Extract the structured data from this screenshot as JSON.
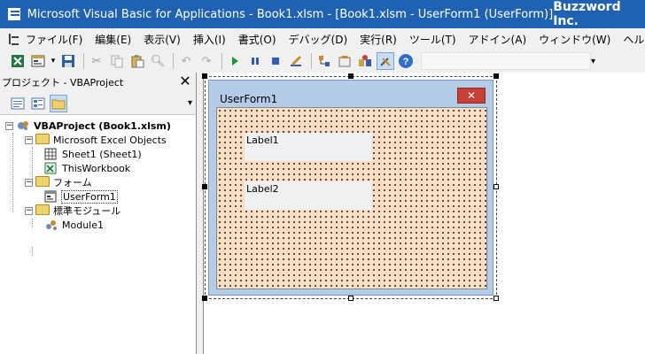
{
  "titlebar": {
    "title": "Microsoft Visual Basic for Applications - Book1.xlsm - [Book1.xlsm - UserForm1 (UserForm)]",
    "brand": "Buzzword Inc."
  },
  "menu": {
    "items": [
      "ファイル(F)",
      "編集(E)",
      "表示(V)",
      "挿入(I)",
      "書式(O)",
      "デバッグ(D)",
      "実行(R)",
      "ツール(T)",
      "アドイン(A)",
      "ウィンドウ(W)",
      "ヘルプ(H)"
    ]
  },
  "project": {
    "title": "プロジェクト - VBAProject",
    "close": "✕",
    "tree": {
      "root": "VBAProject (Book1.xlsm)",
      "excel_objects": "Microsoft Excel Objects",
      "sheet1": "Sheet1 (Sheet1)",
      "thisworkbook": "ThisWorkbook",
      "forms": "フォーム",
      "userform1": "UserForm1",
      "modules": "標準モジュール",
      "module1": "Module1"
    }
  },
  "form": {
    "caption": "UserForm1",
    "close": "✕",
    "label1": "Label1",
    "label2": "Label2"
  },
  "colors": {
    "titlebar": "#1f62b4",
    "form_frame": "#b4cce7",
    "form_back": "#fcdcc2",
    "close_button": "#c84034"
  },
  "icons": {
    "excel": "excel-icon",
    "insert_userform": "insert-userform-icon",
    "save": "save-icon",
    "cut": "cut-icon",
    "copy": "copy-icon",
    "paste": "paste-icon",
    "find": "find-icon",
    "undo": "undo-icon",
    "redo": "redo-icon",
    "run": "run-icon",
    "pause": "pause-icon",
    "reset": "reset-icon",
    "design_mode": "design-mode-icon",
    "project_explorer": "project-explorer-icon",
    "properties": "properties-icon",
    "object_browser": "object-browser-icon",
    "toolbox": "toolbox-icon",
    "help": "help-icon"
  }
}
